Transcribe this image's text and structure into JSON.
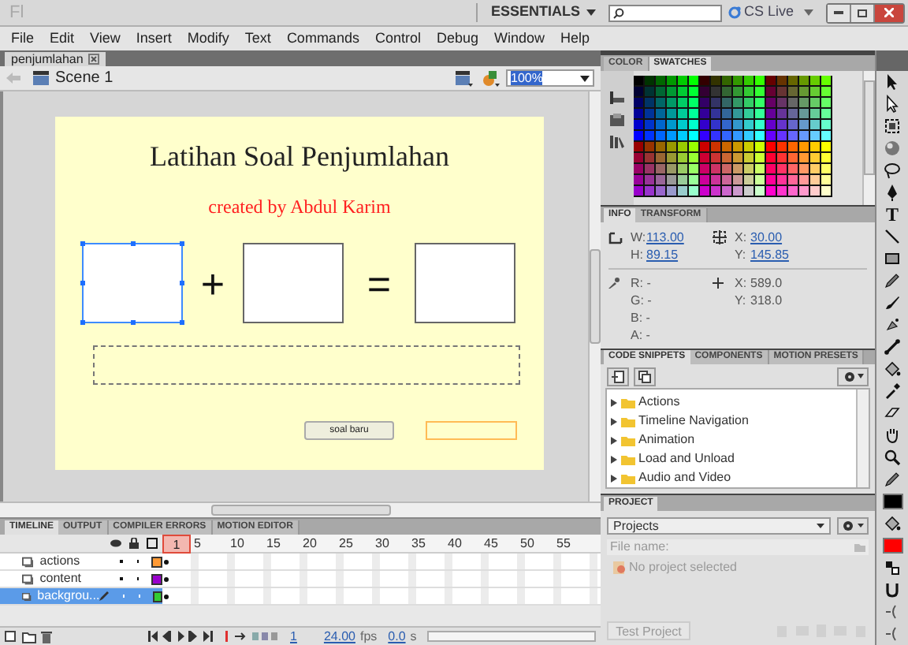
{
  "app_bar": {
    "logo": "Fl",
    "workspace": "ESSENTIALS",
    "cs_live": "CS Live"
  },
  "menu": [
    "File",
    "Edit",
    "View",
    "Insert",
    "Modify",
    "Text",
    "Commands",
    "Control",
    "Debug",
    "Window",
    "Help"
  ],
  "document_tabs": [
    {
      "label": "penjumlahan",
      "selected": true
    }
  ],
  "scene": {
    "label": "Scene 1",
    "zoom": "100%"
  },
  "stage": {
    "title": "Latihan Soal Penjumlahan",
    "subtitle": "created by Abdul Karim",
    "plus": "+",
    "equals": "=",
    "button": "soal baru"
  },
  "color_panel": {
    "tabs": [
      {
        "label": "COLOR",
        "selected": false
      },
      {
        "label": "SWATCHES",
        "selected": true
      }
    ]
  },
  "info_panel": {
    "tabs": [
      {
        "label": "INFO",
        "selected": true
      },
      {
        "label": "TRANSFORM",
        "selected": false
      }
    ],
    "size": [
      {
        "label": "W:",
        "value": "113.00"
      },
      {
        "label": "H:",
        "value": "89.15"
      }
    ],
    "position": [
      {
        "label": "X:",
        "value": "30.00"
      },
      {
        "label": "Y:",
        "value": "145.85"
      }
    ],
    "rgba_readings": [
      "R: -",
      "G: -",
      "B: -",
      "A: -"
    ],
    "cursor": [
      {
        "label": "X:",
        "value": "589.0"
      },
      {
        "label": "Y:",
        "value": "318.0"
      }
    ]
  },
  "snippets_panel": {
    "tabs": [
      {
        "label": "CODE SNIPPETS",
        "selected": true
      },
      {
        "label": "COMPONENTS",
        "selected": false
      },
      {
        "label": "MOTION PRESETS",
        "selected": false
      }
    ],
    "items": [
      {
        "label": "Actions",
        "expanded": false
      },
      {
        "label": "Timeline Navigation",
        "expanded": false
      },
      {
        "label": "Animation",
        "expanded": false
      },
      {
        "label": "Load and Unload",
        "expanded": false
      },
      {
        "label": "Audio and Video",
        "expanded": false
      }
    ]
  },
  "project_panel": {
    "tabs": [
      {
        "label": "PROJECT",
        "selected": true
      }
    ],
    "dropdown": "Projects",
    "file_label": "File name:",
    "message": "No project selected",
    "button": {
      "label": "Test Project",
      "disabled": true
    }
  },
  "timeline": {
    "tabs": [
      {
        "label": "TIMELINE",
        "selected": true
      },
      {
        "label": "OUTPUT",
        "selected": false
      },
      {
        "label": "COMPILER ERRORS",
        "selected": false
      },
      {
        "label": "MOTION EDITOR",
        "selected": false
      }
    ],
    "frame_numbers": [
      "1",
      "5",
      "10",
      "15",
      "20",
      "25",
      "30",
      "35",
      "40",
      "45",
      "50",
      "55"
    ],
    "layers": [
      {
        "name": "actions",
        "color": "#ff9933",
        "selected": false
      },
      {
        "name": "content",
        "color": "#9900cc",
        "selected": false
      },
      {
        "name": "backgrou...",
        "color": "#33cc33",
        "selected": true
      }
    ],
    "current_frame": "1",
    "fps": "24.00",
    "fps_unit": "fps",
    "time": "0.0",
    "time_unit": "s"
  },
  "tools": [
    {
      "kind": "selection"
    },
    {
      "kind": "subselection"
    },
    {
      "kind": "transform"
    },
    {
      "kind": "sphere"
    },
    {
      "kind": "lasso"
    },
    {
      "kind": "pen"
    },
    {
      "kind": "text",
      "label": "T"
    },
    {
      "kind": "line"
    },
    {
      "kind": "rect"
    },
    {
      "kind": "pencil"
    },
    {
      "kind": "brush"
    },
    {
      "kind": "spray"
    },
    {
      "kind": "bone"
    },
    {
      "kind": "bucket"
    },
    {
      "kind": "eyedropper"
    },
    {
      "kind": "eraser"
    },
    {
      "kind": "hand"
    },
    {
      "kind": "zoom"
    },
    {
      "kind": "pencil"
    },
    {
      "kind": "swatch",
      "color": "#000000"
    },
    {
      "kind": "bucket"
    },
    {
      "kind": "swatch",
      "color": "#ff0000"
    },
    {
      "kind": "swap"
    },
    {
      "kind": "magnet"
    },
    {
      "kind": "curve"
    },
    {
      "kind": "curve"
    }
  ]
}
